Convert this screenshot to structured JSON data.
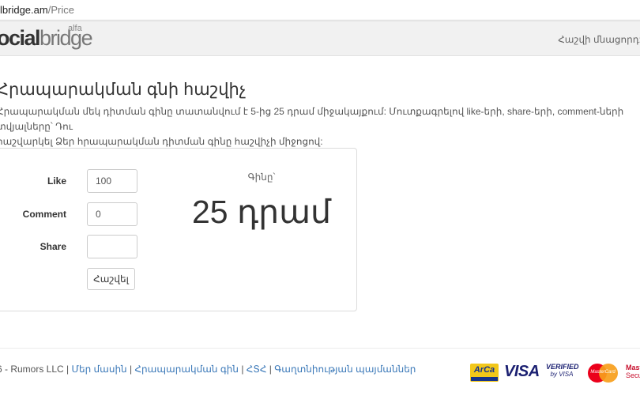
{
  "browser": {
    "url_host": "lbridge.am",
    "url_path": "/Price"
  },
  "header": {
    "logo_part1": "ocial",
    "logo_part2": "bridge",
    "logo_badge": "alfa",
    "balance_label": "Հաշվի մնացորդ:"
  },
  "page": {
    "title": "Հրապարակման գնի հաշվիչ",
    "description": "Հրապարակման մեկ դիտման գինը տատանվում է 5-ից 25 դրամ միջակայքում: Մուտքագրելով like-երի, share-երի, comment-ների տվյալները՝ Դու\nհաշվարկել Ձեր հրապարակման դիտման գինը հաշվիչի միջոցով:"
  },
  "calculator": {
    "like_label": "Like",
    "like_value": "100",
    "comment_label": "Comment",
    "comment_value": "0",
    "share_label": "Share",
    "share_value": "",
    "calc_button": "Հաշվել",
    "price_label": "Գինը՝",
    "price_value": "25 դրամ"
  },
  "footer": {
    "copyright": "6 - Rumors LLC |",
    "links": [
      "Մեր մասին",
      "Հրապարակման գին",
      "ՀՏՀ",
      "Գաղտնիության պայմաններ"
    ]
  },
  "payments": {
    "arca": "ArCa",
    "visa": "VISA",
    "vbv_line1": "VERIFIED",
    "vbv_line2": "by VISA",
    "mastercard": "MasterCard",
    "mc_secure1": "Mast",
    "mc_secure2": "Secu",
    "colors": {
      "visa_blue": "#1a1f71",
      "mc_red": "#eb001b",
      "mc_orange": "#f79e1b",
      "arca_yellow": "#f2c71a"
    }
  }
}
